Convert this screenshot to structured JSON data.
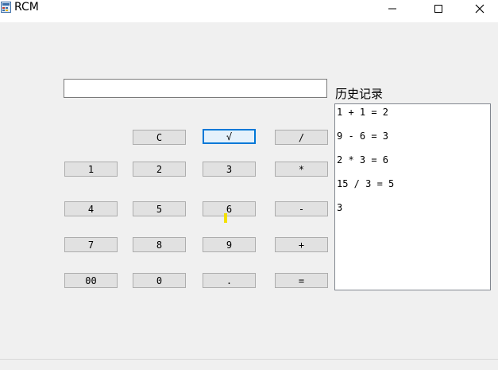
{
  "window": {
    "title": "RCM",
    "minimize_icon": "minimize-icon",
    "maximize_icon": "maximize-icon",
    "close_icon": "close-icon"
  },
  "display": {
    "value": ""
  },
  "history": {
    "label": "历史记录",
    "items": [
      "1 + 1 = 2",
      "9 - 6 = 3",
      "2 * 3 = 6",
      "15 / 3 = 5",
      "3"
    ]
  },
  "keys": {
    "clear": "C",
    "sqrt": "√",
    "divide": "/",
    "one": "1",
    "two": "2",
    "three": "3",
    "multiply": "*",
    "four": "4",
    "five": "5",
    "six": "6",
    "minus": "-",
    "seven": "7",
    "eight": "8",
    "nine": "9",
    "plus": "+",
    "double_zero": "00",
    "zero": "0",
    "dot": ".",
    "equals": "="
  }
}
